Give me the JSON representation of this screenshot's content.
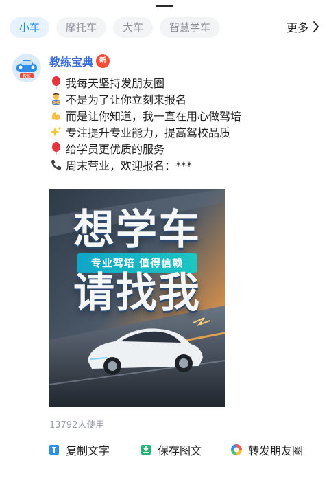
{
  "tabs": [
    {
      "label": "小车",
      "active": true
    },
    {
      "label": "摩托车",
      "active": false
    },
    {
      "label": "大车",
      "active": false
    },
    {
      "label": "智慧学车",
      "active": false
    }
  ],
  "more_label": "更多",
  "post": {
    "author": "教练宝典",
    "badge": "新",
    "avatar_caption": "教练",
    "lines": [
      {
        "icon": "balloon-icon",
        "text": "我每天坚持发朋友圈"
      },
      {
        "icon": "person-gesture-icon",
        "text": "不是为了让你立刻来报名"
      },
      {
        "icon": "flexed-biceps-icon",
        "text": "而是让你知道，我一直在用心做驾培"
      },
      {
        "icon": "sparkles-icon",
        "text": "专注提升专业能力，提高驾校品质"
      },
      {
        "icon": "balloon-icon",
        "text": "给学员更优质的服务"
      },
      {
        "icon": "phone-icon",
        "text": "周末营业，欢迎报名：***"
      }
    ],
    "poster": {
      "headline_top": "想学车",
      "tagline": "专业驾培 值得信赖",
      "headline_bottom": "请找我"
    },
    "usage": "13792人使用"
  },
  "actions": {
    "copy_text": "复制文字",
    "save_image": "保存图文",
    "share_moments": "转发朋友圈"
  },
  "colors": {
    "accent_blue": "#1f8ef1",
    "author_blue": "#3b6bd6",
    "badge_red": "#ff4b36",
    "muted_gray": "#9a9ea6"
  }
}
